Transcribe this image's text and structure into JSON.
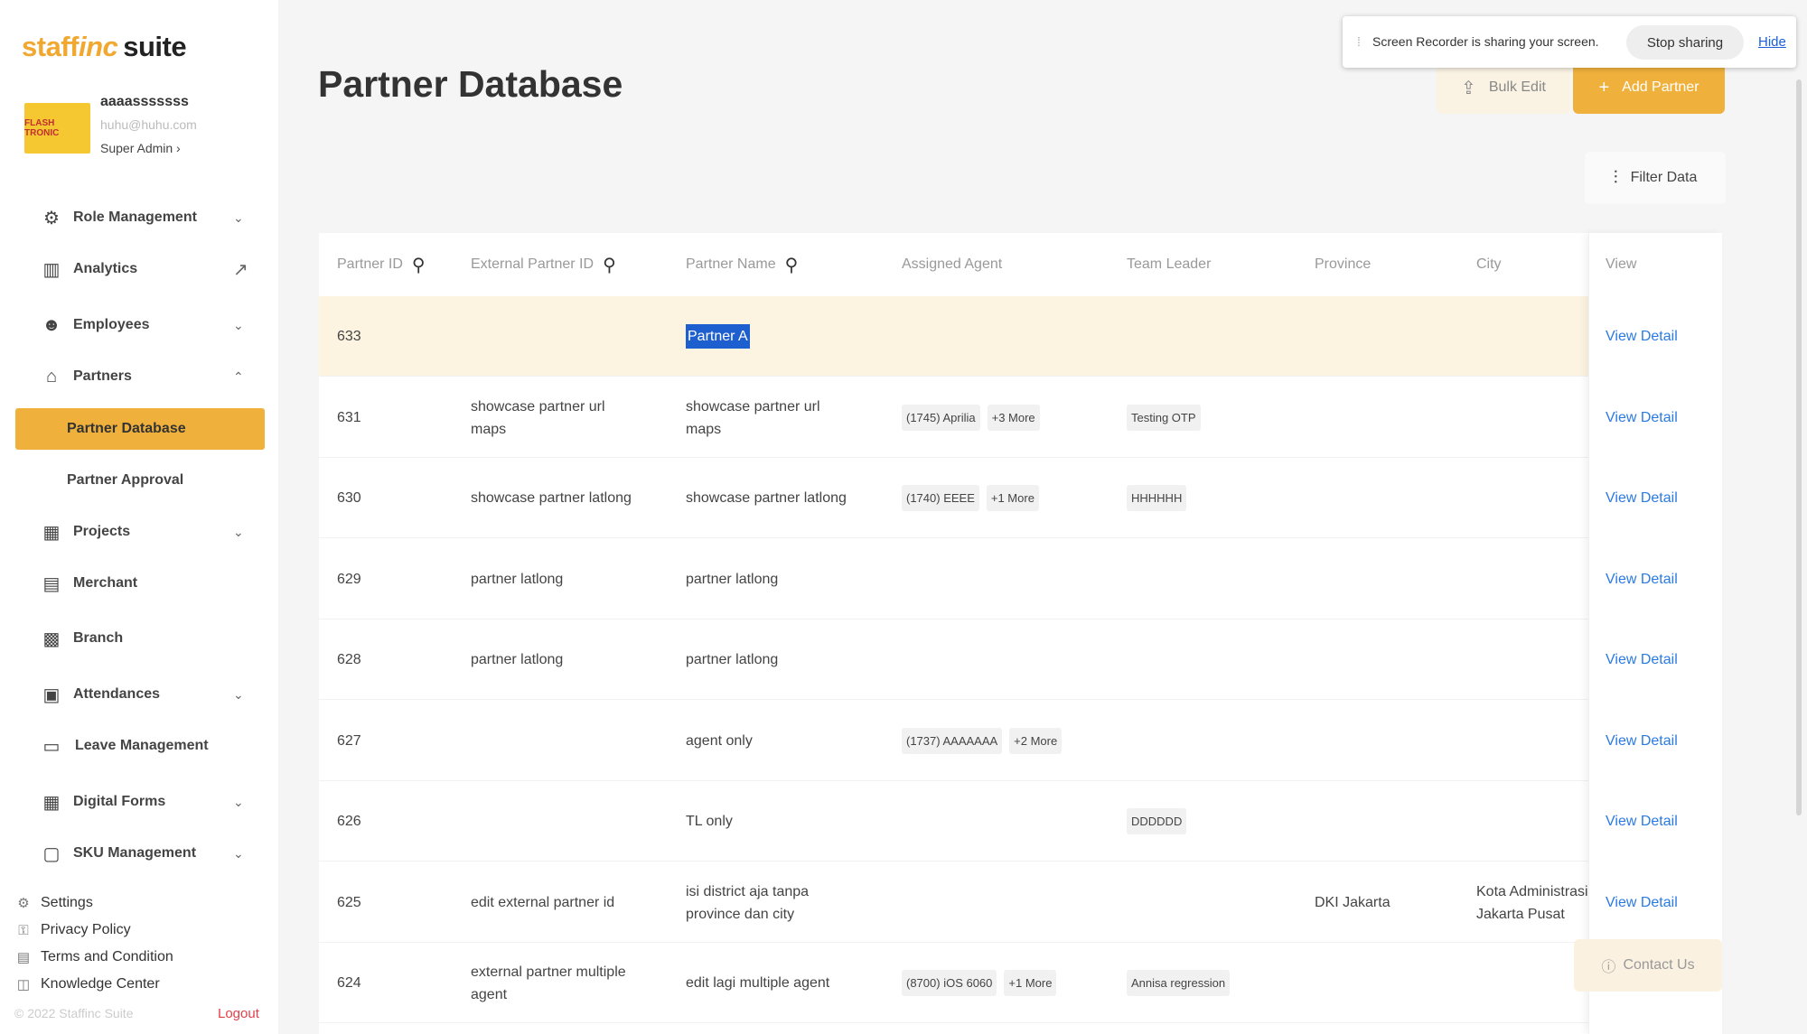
{
  "brand": {
    "logo_part1": "staff",
    "logo_part2": "inc",
    "logo_part3": "suite"
  },
  "profile": {
    "name": "aaaasssssss",
    "email": "huhu@huhu.com",
    "role": "Super Admin ›",
    "avatar_text": "FLASH TRONIC"
  },
  "sidebar": {
    "items": [
      {
        "label": "Role Management",
        "icon": "role-icon",
        "chevron": "⌄"
      },
      {
        "label": "Analytics",
        "icon": "analytics-icon",
        "chevron": "↗"
      },
      {
        "label": "Employees",
        "icon": "employees-icon",
        "chevron": "⌄"
      },
      {
        "label": "Partners",
        "icon": "partners-icon",
        "chevron": "⌃"
      },
      {
        "label": "Projects",
        "icon": "projects-icon",
        "chevron": "⌄"
      },
      {
        "label": "Merchant",
        "icon": "merchant-icon",
        "chevron": ""
      },
      {
        "label": "Branch",
        "icon": "branch-icon",
        "chevron": ""
      },
      {
        "label": "Attendances",
        "icon": "attendances-icon",
        "chevron": "⌄"
      },
      {
        "label": "Leave Management",
        "icon": "calendar-icon",
        "chevron": ""
      },
      {
        "label": "Digital Forms",
        "icon": "forms-icon",
        "chevron": "⌄"
      },
      {
        "label": "SKU Management",
        "icon": "sku-icon",
        "chevron": "⌄"
      }
    ],
    "sub_items": [
      {
        "label": "Partner Database",
        "active": true
      },
      {
        "label": "Partner Approval",
        "active": false
      }
    ],
    "bottom_links": [
      "Settings",
      "Privacy Policy",
      "Terms and Condition",
      "Knowledge Center"
    ],
    "copyright": "© 2022 Staffinc Suite",
    "logout": "Logout",
    "accent_color": "#f0b13c"
  },
  "page": {
    "title": "Partner Database"
  },
  "toolbar": {
    "bulk_edit": "Bulk Edit",
    "add_partner": "Add Partner",
    "filter": "Filter Data"
  },
  "recorder": {
    "message": "Screen Recorder is sharing your screen.",
    "stop": "Stop sharing",
    "hide": "Hide"
  },
  "table": {
    "columns": [
      "Partner ID",
      "External Partner ID",
      "Partner Name",
      "Assigned Agent",
      "Team Leader",
      "Province",
      "City",
      "View"
    ],
    "rows": [
      {
        "id": "633",
        "ext": "",
        "name": "Partner A",
        "agent": "",
        "agent_more": "",
        "tl": "",
        "province": "",
        "city": "",
        "view": "View Detail"
      },
      {
        "id": "631",
        "ext": "showcase partner url maps",
        "name": "showcase partner url maps",
        "agent": "(1745) Aprilia",
        "agent_more": "+3 More",
        "tl": "Testing OTP",
        "province": "",
        "city": "",
        "view": "View Detail"
      },
      {
        "id": "630",
        "ext": "showcase partner latlong",
        "name": "showcase partner latlong",
        "agent": "(1740) EEEE",
        "agent_more": "+1 More",
        "tl": "HHHHHH",
        "province": "",
        "city": "",
        "view": "View Detail"
      },
      {
        "id": "629",
        "ext": "partner latlong",
        "name": "partner latlong",
        "agent": "",
        "agent_more": "",
        "tl": "",
        "province": "",
        "city": "",
        "view": "View Detail"
      },
      {
        "id": "628",
        "ext": "partner latlong",
        "name": "partner latlong",
        "agent": "",
        "agent_more": "",
        "tl": "",
        "province": "",
        "city": "",
        "view": "View Detail"
      },
      {
        "id": "627",
        "ext": "",
        "name": "agent only",
        "agent": "(1737) AAAAAAA",
        "agent_more": "+2 More",
        "tl": "",
        "province": "",
        "city": "",
        "view": "View Detail"
      },
      {
        "id": "626",
        "ext": "",
        "name": "TL only",
        "agent": "",
        "agent_more": "",
        "tl": "DDDDDD",
        "province": "",
        "city": "",
        "view": "View Detail"
      },
      {
        "id": "625",
        "ext": "edit external partner id",
        "name": "isi district aja tanpa province dan city",
        "agent": "",
        "agent_more": "",
        "tl": "",
        "province": "DKI Jakarta",
        "city": "Kota Administrasi Jakarta Pusat",
        "view": "View Detail"
      },
      {
        "id": "624",
        "ext": "external partner multiple agent",
        "name": "edit lagi multiple agent",
        "agent": "(8700) iOS 6060",
        "agent_more": "+1 More",
        "tl": "Annisa regression",
        "province": "",
        "city": "",
        "view": "View Detail"
      }
    ]
  },
  "contact": {
    "label": "Contact Us"
  }
}
